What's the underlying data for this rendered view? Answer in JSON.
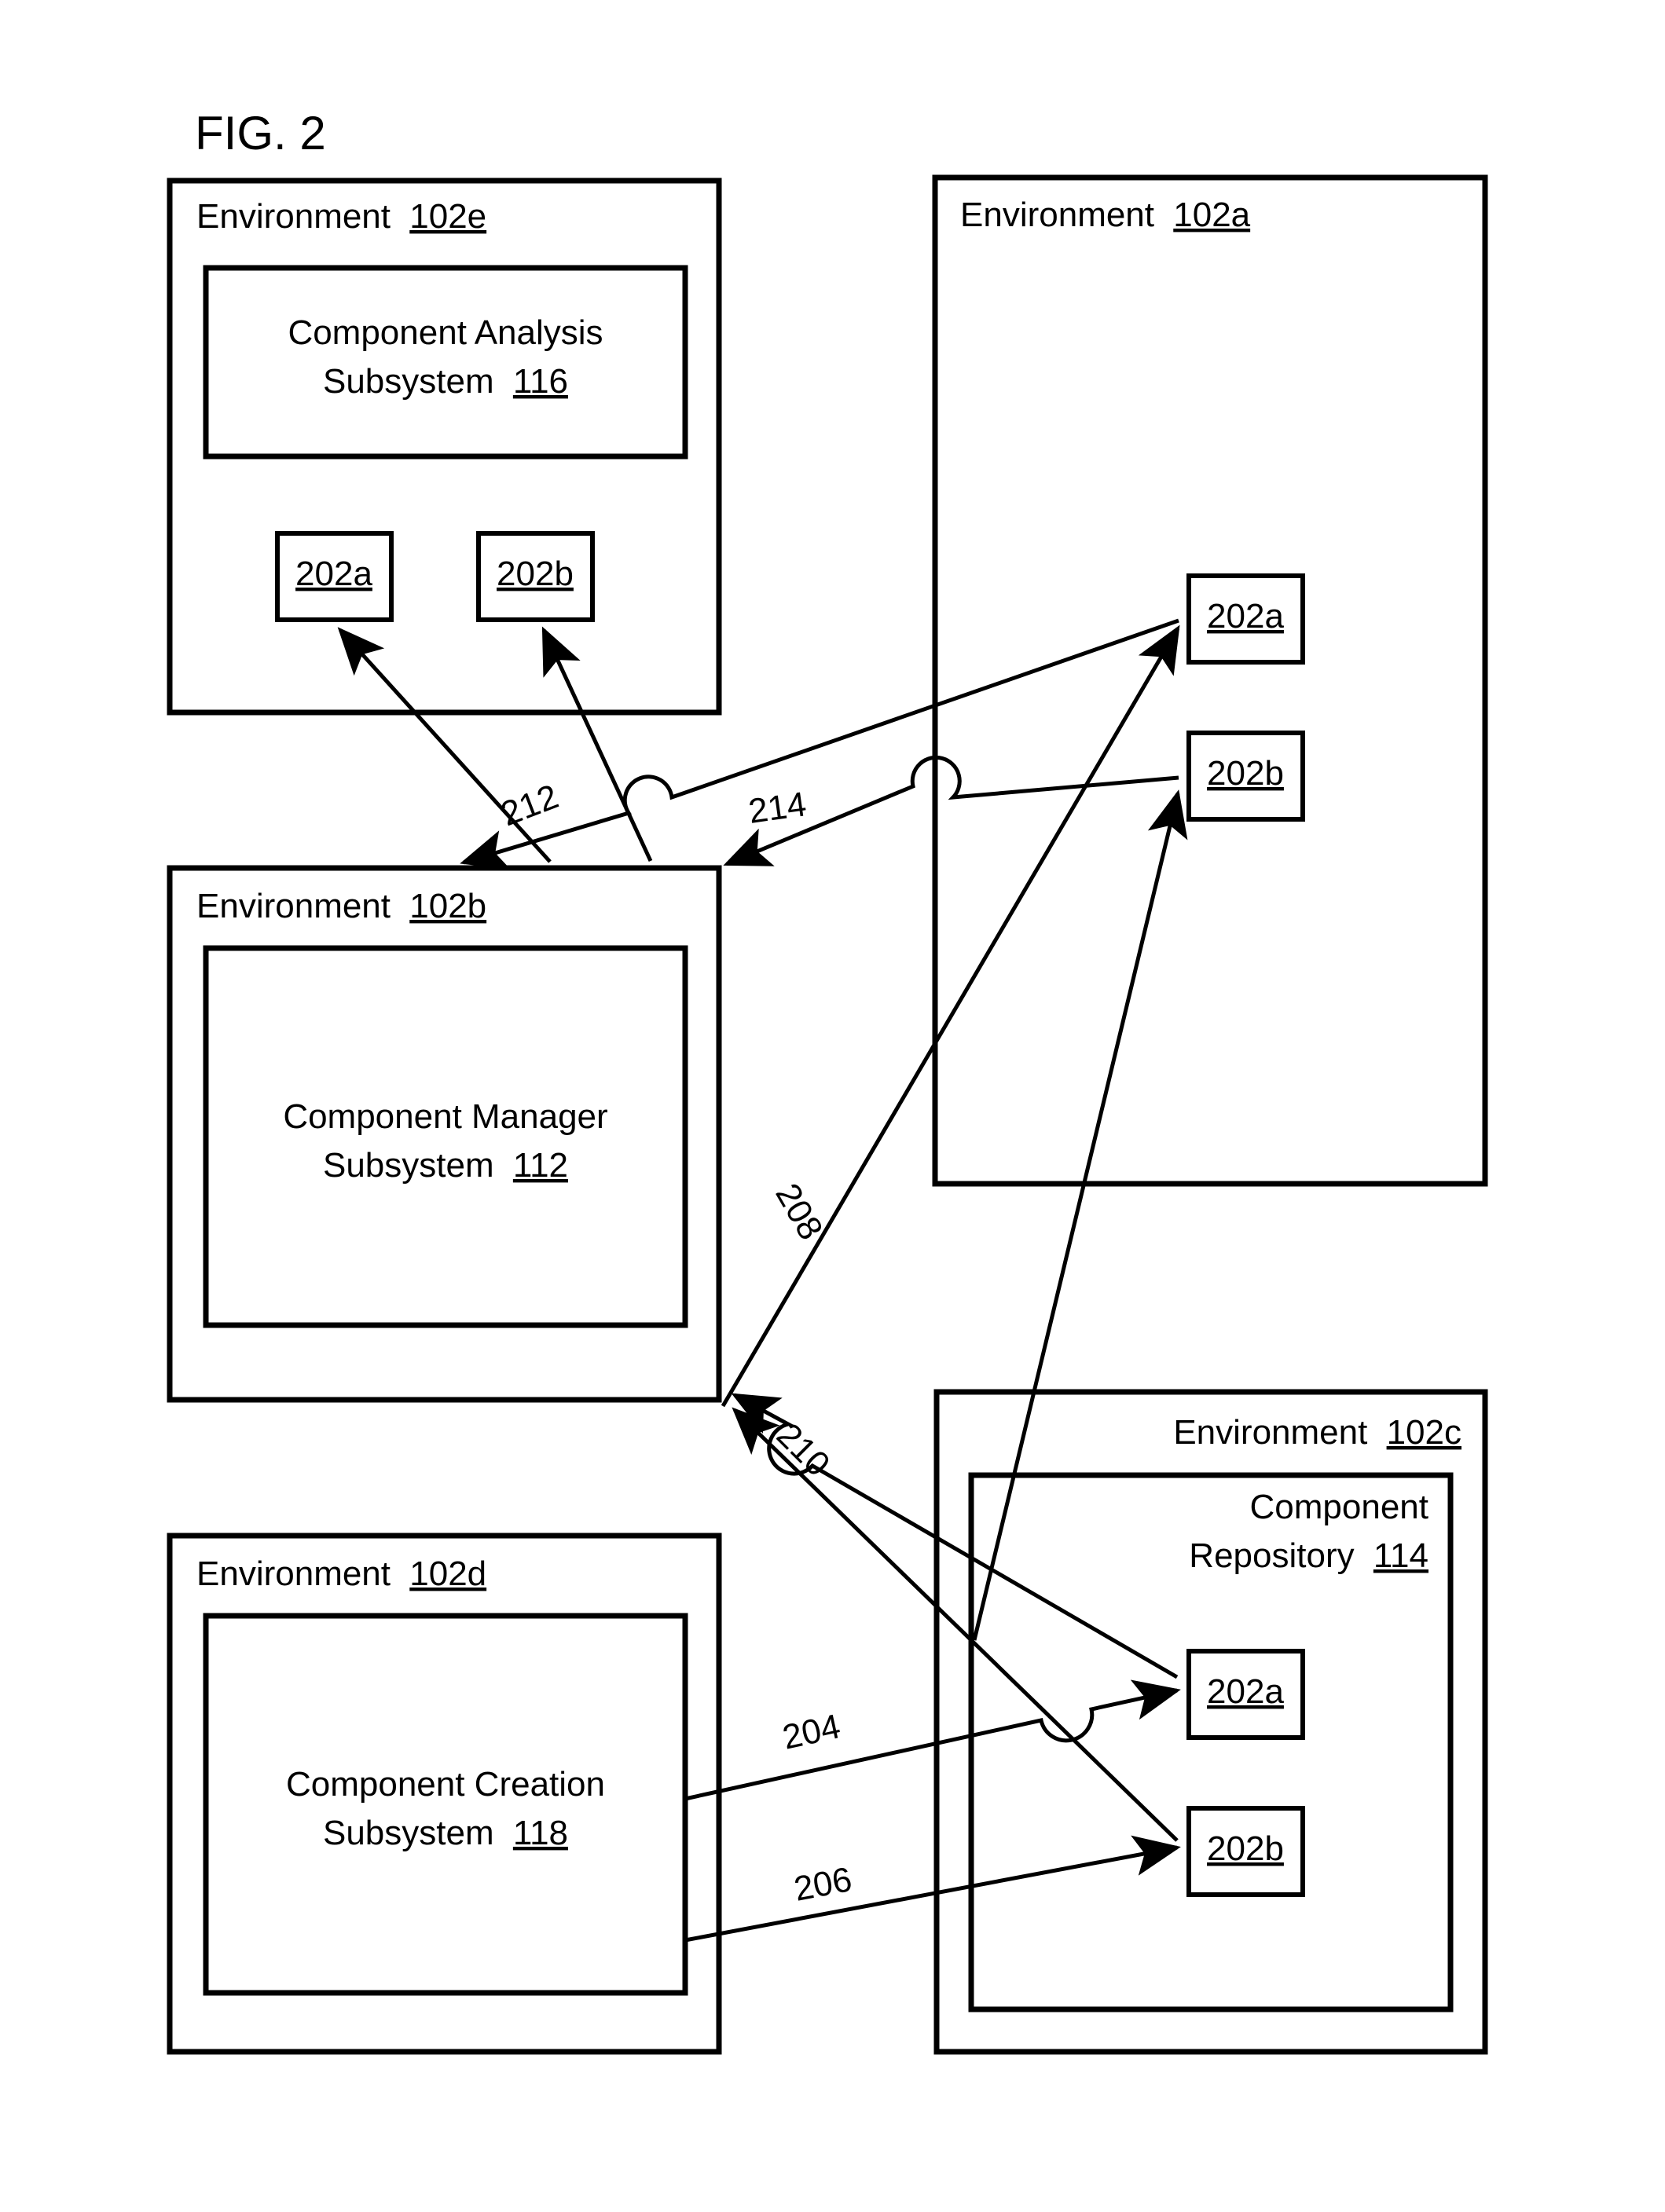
{
  "figure": {
    "title": "FIG. 2"
  },
  "environments": {
    "e102e": {
      "label_prefix": "Environment",
      "ref": "102e",
      "subsystem": {
        "line1": "Component Analysis",
        "line2_prefix": "Subsystem",
        "line2_ref": "116"
      },
      "components": [
        {
          "ref": "202a"
        },
        {
          "ref": "202b"
        }
      ]
    },
    "e102a": {
      "label_prefix": "Environment",
      "ref": "102a",
      "components": [
        {
          "ref": "202a"
        },
        {
          "ref": "202b"
        }
      ]
    },
    "e102b": {
      "label_prefix": "Environment",
      "ref": "102b",
      "subsystem": {
        "line1": "Component Manager",
        "line2_prefix": "Subsystem",
        "line2_ref": "112"
      }
    },
    "e102c": {
      "label_prefix": "Environment",
      "ref": "102c",
      "repository": {
        "line1": "Component",
        "line2_prefix": "Repository",
        "line2_ref": "114"
      },
      "components": [
        {
          "ref": "202a"
        },
        {
          "ref": "202b"
        }
      ]
    },
    "e102d": {
      "label_prefix": "Environment",
      "ref": "102d",
      "subsystem": {
        "line1": "Component Creation",
        "line2_prefix": "Subsystem",
        "line2_ref": "118"
      }
    }
  },
  "connectors": [
    {
      "id": "c204",
      "label": "204"
    },
    {
      "id": "c206",
      "label": "206"
    },
    {
      "id": "c208",
      "label": "208"
    },
    {
      "id": "c210",
      "label": "210"
    },
    {
      "id": "c212",
      "label": "212"
    },
    {
      "id": "c214",
      "label": "214"
    }
  ],
  "colors": {
    "stroke": "#000000",
    "fill": "#ffffff"
  }
}
